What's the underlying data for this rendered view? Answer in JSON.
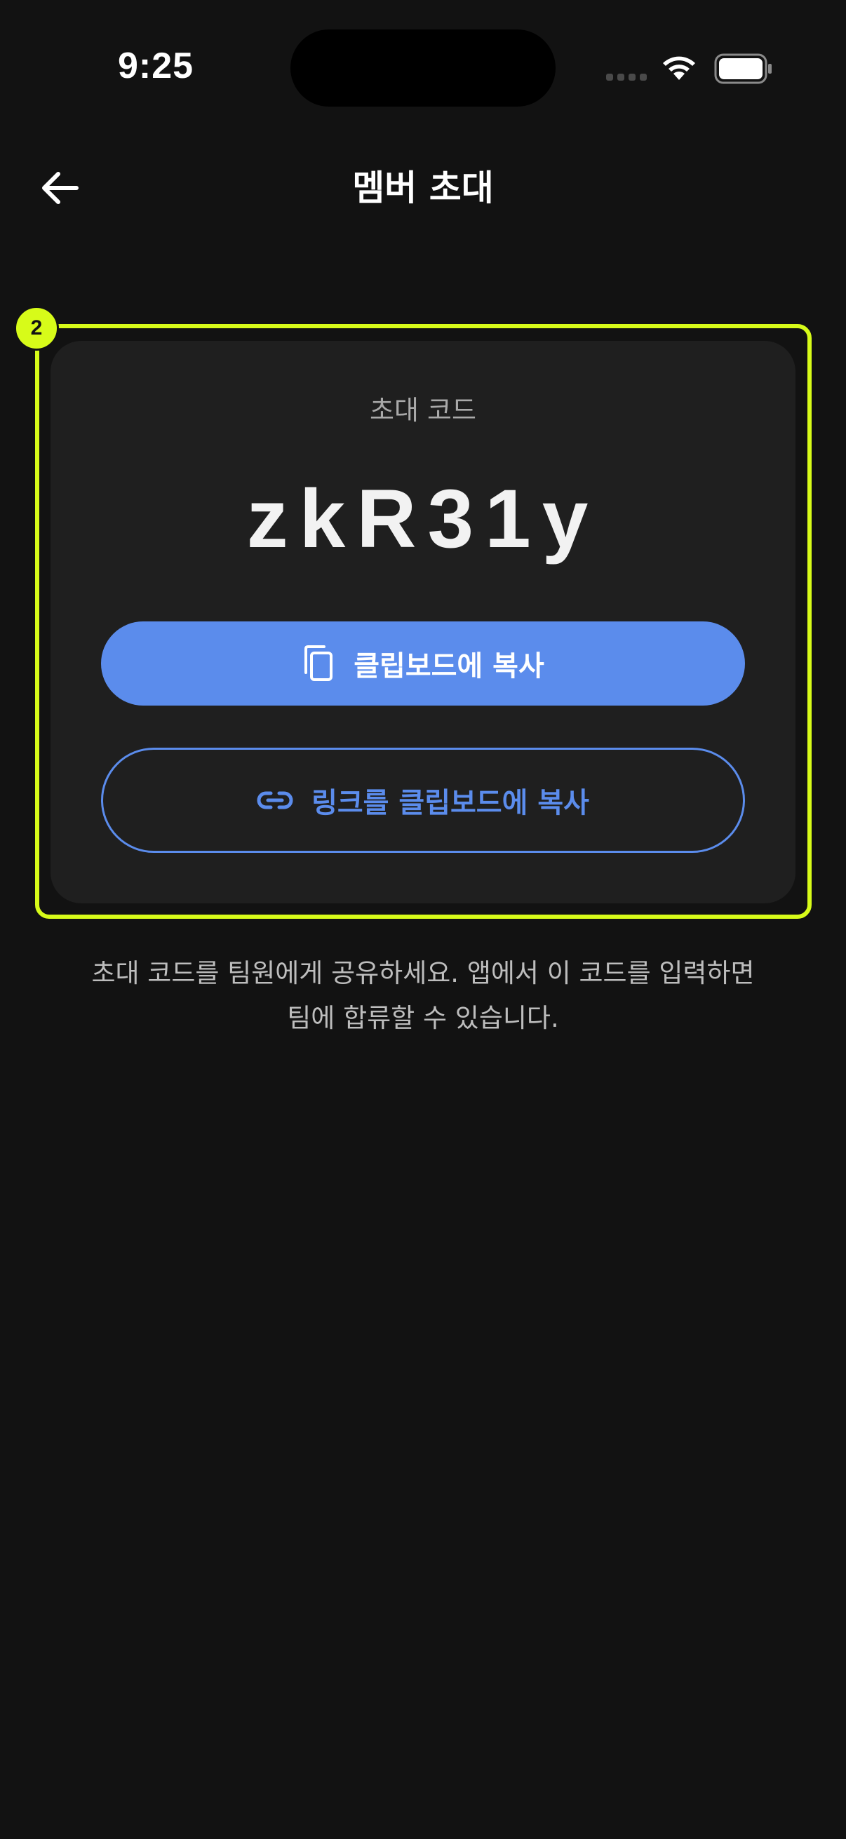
{
  "status_bar": {
    "time": "9:25"
  },
  "header": {
    "title": "멤버 초대",
    "back_icon": "arrow-left-icon"
  },
  "annotation": {
    "badge_label": "2",
    "color": "#d7fb19"
  },
  "invite_card": {
    "caption": "초대 코드",
    "code": "zkR31y",
    "copy_button": {
      "label": "클립보드에 복사",
      "icon": "copy-icon"
    },
    "copy_link_button": {
      "label": "링크를 클립보드에 복사",
      "icon": "link-icon"
    }
  },
  "helper_text": {
    "line1": "초대 코드를 팀원에게 공유하세요. 앱에서 이 코드를 입력하면",
    "line2": "팀에 합류할 수 있습니다."
  },
  "colors": {
    "background": "#121212",
    "card": "#1f1f1f",
    "accent": "#5b8cec",
    "highlight": "#d7fb19"
  }
}
